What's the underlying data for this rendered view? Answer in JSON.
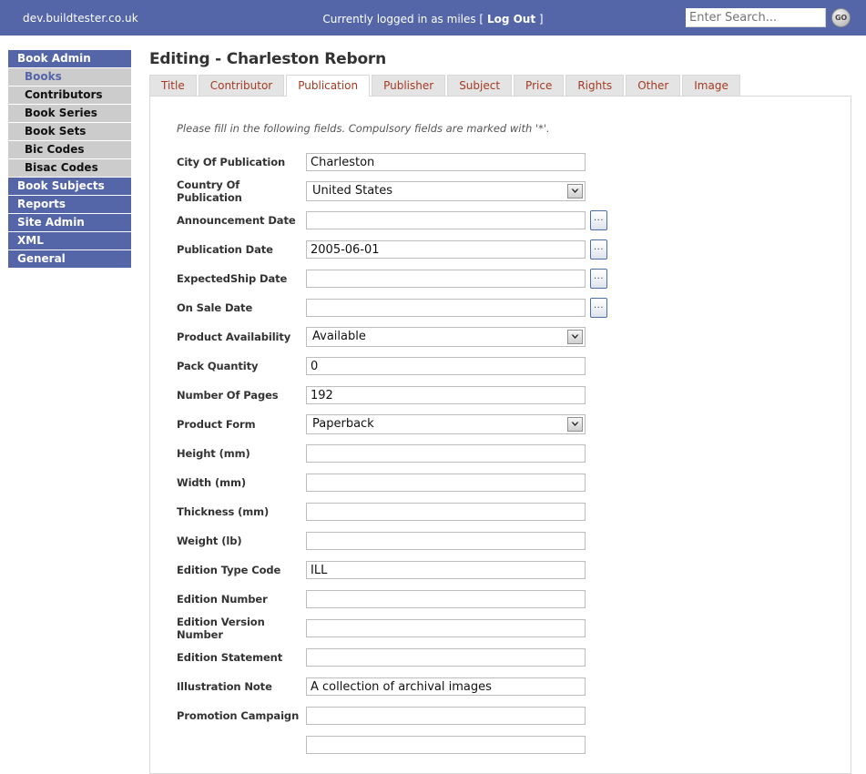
{
  "header": {
    "site_domain": "dev.buildtester.co.uk",
    "login_prefix": "Currently logged in as miles [ ",
    "logout_label": "Log Out",
    "login_suffix": " ]",
    "search_placeholder": "Enter Search...",
    "search_value": "",
    "go_label": "GO",
    "bar_color": "#5465a8"
  },
  "sidebar": {
    "items": [
      {
        "label": "Book Admin",
        "type": "section",
        "current": false
      },
      {
        "label": "Books",
        "type": "sub",
        "current": true
      },
      {
        "label": "Contributors",
        "type": "sub",
        "current": false
      },
      {
        "label": "Book Series",
        "type": "sub",
        "current": false
      },
      {
        "label": "Book Sets",
        "type": "sub",
        "current": false
      },
      {
        "label": "Bic Codes",
        "type": "sub",
        "current": false
      },
      {
        "label": "Bisac Codes",
        "type": "sub",
        "current": false
      },
      {
        "label": "Book Subjects",
        "type": "section",
        "current": false
      },
      {
        "label": "Reports",
        "type": "section",
        "current": false
      },
      {
        "label": "Site Admin",
        "type": "section",
        "current": false
      },
      {
        "label": "XML",
        "type": "section",
        "current": false
      },
      {
        "label": "General",
        "type": "section",
        "current": false
      }
    ]
  },
  "main": {
    "page_title": "Editing - Charleston Reborn",
    "tabs": [
      {
        "label": "Title",
        "active": false
      },
      {
        "label": "Contributor",
        "active": false
      },
      {
        "label": "Publication",
        "active": true
      },
      {
        "label": "Publisher",
        "active": false
      },
      {
        "label": "Subject",
        "active": false
      },
      {
        "label": "Price",
        "active": false
      },
      {
        "label": "Rights",
        "active": false
      },
      {
        "label": "Other",
        "active": false
      },
      {
        "label": "Image",
        "active": false
      }
    ],
    "form_hint": "Please fill in the following fields. Compulsory fields are marked with '*'.",
    "fields": [
      {
        "label": "City Of Publication",
        "kind": "text",
        "value": "Charleston",
        "picker": false
      },
      {
        "label": "Country Of Publication",
        "kind": "select",
        "value": "United States",
        "picker": false
      },
      {
        "label": "Announcement Date",
        "kind": "text",
        "value": "",
        "picker": true
      },
      {
        "label": "Publication Date",
        "kind": "text",
        "value": "2005-06-01",
        "picker": true
      },
      {
        "label": "ExpectedShip Date",
        "kind": "text",
        "value": "",
        "picker": true
      },
      {
        "label": "On Sale Date",
        "kind": "text",
        "value": "",
        "picker": true
      },
      {
        "label": "Product Availability",
        "kind": "select",
        "value": "Available",
        "picker": false
      },
      {
        "label": "Pack Quantity",
        "kind": "text",
        "value": "0",
        "picker": false
      },
      {
        "label": "Number Of Pages",
        "kind": "text",
        "value": "192",
        "picker": false
      },
      {
        "label": "Product Form",
        "kind": "select",
        "value": "Paperback",
        "picker": false
      },
      {
        "label": "Height (mm)",
        "kind": "text",
        "value": "",
        "picker": false
      },
      {
        "label": "Width (mm)",
        "kind": "text",
        "value": "",
        "picker": false
      },
      {
        "label": "Thickness (mm)",
        "kind": "text",
        "value": "",
        "picker": false
      },
      {
        "label": "Weight (lb)",
        "kind": "text",
        "value": "",
        "picker": false
      },
      {
        "label": "Edition Type Code",
        "kind": "text",
        "value": "ILL",
        "picker": false
      },
      {
        "label": "Edition Number",
        "kind": "text",
        "value": "",
        "picker": false
      },
      {
        "label": "Edition Version Number",
        "kind": "text",
        "value": "",
        "picker": false
      },
      {
        "label": "Edition Statement",
        "kind": "text",
        "value": "",
        "picker": false
      },
      {
        "label": "Illustration Note",
        "kind": "text",
        "value": "A collection of archival images",
        "picker": false
      },
      {
        "label": "Promotion Campaign",
        "kind": "text",
        "value": "",
        "picker": false
      },
      {
        "label": "",
        "kind": "text",
        "value": "",
        "picker": false
      }
    ],
    "dots_label": "..."
  }
}
